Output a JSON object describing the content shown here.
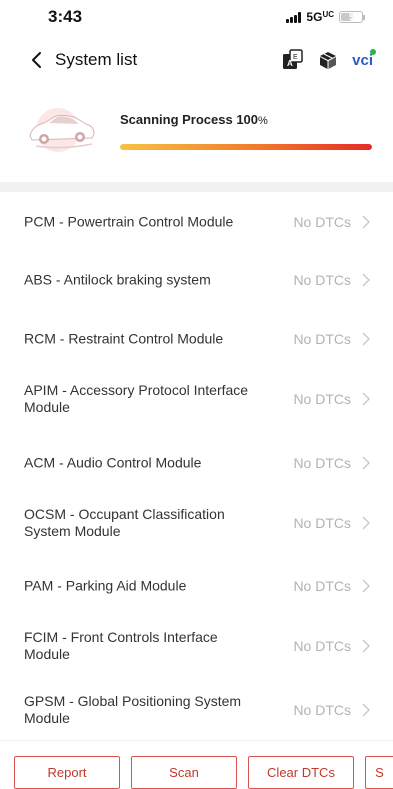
{
  "status_bar": {
    "time": "3:43",
    "network": "5G",
    "battery_level": "5"
  },
  "nav": {
    "title": "System list",
    "vci_label": "vci"
  },
  "scan": {
    "title": "Scanning Process 100",
    "percent_sign": "%",
    "progress_percent": 100
  },
  "modules": [
    {
      "name": "PCM - Powertrain Control Module",
      "status": "No DTCs"
    },
    {
      "name": "ABS - Antilock braking system",
      "status": "No DTCs"
    },
    {
      "name": "RCM - Restraint Control Module",
      "status": "No DTCs"
    },
    {
      "name": "APIM - Accessory Protocol Interface Module",
      "status": "No DTCs"
    },
    {
      "name": "ACM - Audio Control Module",
      "status": "No DTCs"
    },
    {
      "name": "OCSM - Occupant Classification System Module",
      "status": "No DTCs"
    },
    {
      "name": "PAM - Parking Aid Module",
      "status": "No DTCs"
    },
    {
      "name": "FCIM - Front Controls Interface Module",
      "status": "No DTCs"
    },
    {
      "name": "GPSM - Global Positioning System Module",
      "status": "No DTCs"
    }
  ],
  "bottom_actions": {
    "report": "Report",
    "scan": "Scan",
    "clear_dtcs": "Clear DTCs",
    "partial": "S"
  },
  "colors": {
    "accent_red": "#c0392b",
    "vci_blue": "#2a5cc8",
    "status_gray": "#b3b3b3"
  }
}
